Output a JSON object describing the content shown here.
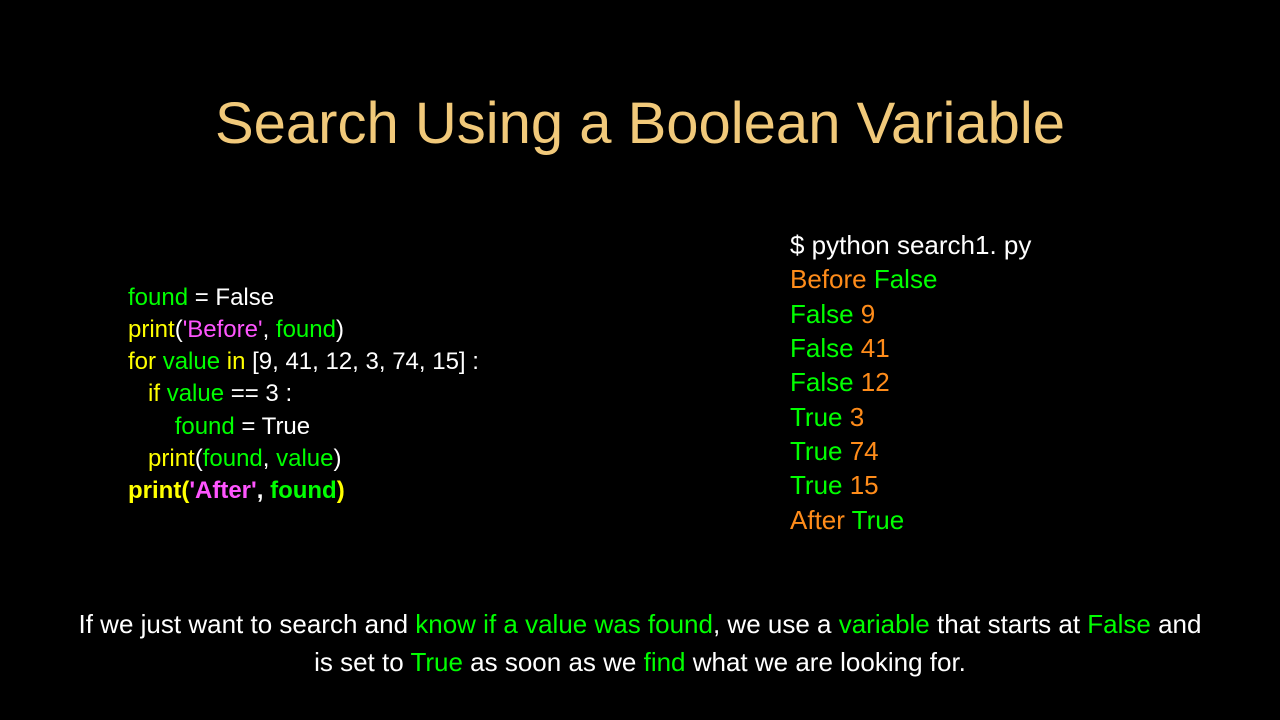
{
  "title": "Search Using a Boolean Variable",
  "code": {
    "l1_found": "found",
    "l1_eq_false": " = False",
    "l2_print": "print",
    "l2_open": "(",
    "l2_str": "'Before'",
    "l2_comma_sp": ", ",
    "l2_found": "found",
    "l2_close": ")",
    "l3_for": "for",
    "l3_sp": " ",
    "l3_value": "value",
    "l3_sp2": " ",
    "l3_in": "in",
    "l3_rest": " [9, 41, 12, 3, 74, 15] :",
    "l4_indent": "   ",
    "l4_if": "if",
    "l4_sp": " ",
    "l4_value": "value",
    "l4_rest": " == 3 :",
    "l5_indent": "       ",
    "l5_found": "found",
    "l5_rest": " = True",
    "l6_indent": "   ",
    "l6_print": "print",
    "l6_open": "(",
    "l6_found": "found",
    "l6_comma": ", ",
    "l6_value": "value",
    "l6_close": ")",
    "l7_print": "print(",
    "l7_str": "'After'",
    "l7_comma": ", ",
    "l7_found": "found",
    "l7_close": ")"
  },
  "output": {
    "cmd": "$ python search1. py",
    "l1a": "Before",
    "l1b": " False",
    "l2a": "False",
    "l2b": " 9",
    "l3a": "False",
    "l3b": " 41",
    "l4a": "False",
    "l4b": " 12",
    "l5a": "True",
    "l5b": " 3",
    "l6a": "True",
    "l6b": " 74",
    "l7a": "True",
    "l7b": " 15",
    "l8a": "After",
    "l8b": " True"
  },
  "caption": {
    "t1": "If we just want to search and ",
    "t2": "know if a value was found",
    "t3": ", we use a ",
    "t4": "variable",
    "t5": " that starts at ",
    "t6": "False",
    "t7": " and is set to ",
    "t8": "True",
    "t9": " as soon as we ",
    "t10": "find",
    "t11": " what we are looking for."
  }
}
